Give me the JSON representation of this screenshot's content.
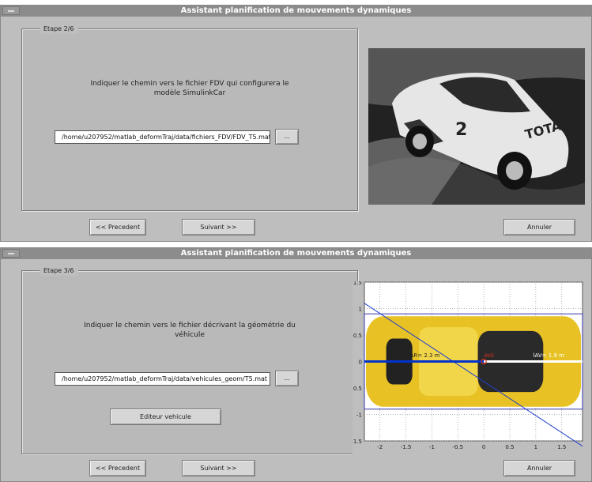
{
  "windows": [
    {
      "title": "Assistant planification de mouvements dynamiques",
      "step": "Etape 2/6",
      "prompt_line1": "Indiquer le chemin vers le fichier FDV qui configurera le",
      "prompt_line2": "modèle SimulinkCar",
      "path": "/home/u207952/matlab_deformTraj/data/fichiers_FDV/FDV_T5.mat",
      "browse_label": "...",
      "prev_label": "<< Precedent",
      "next_label": "Suivant >>",
      "cancel_label": "Annuler"
    },
    {
      "title": "Assistant planification de mouvements dynamiques",
      "step": "Etape 3/6",
      "prompt_line1": "Indiquer le chemin vers le fichier décrivant la géométrie du",
      "prompt_line2": "véhicule",
      "path": "/home/u207952/matlab_deformTraj/data/vehicules_geom/T5.mat",
      "browse_label": "...",
      "editor_label": "Editeur vehicule",
      "prev_label": "<< Precedent",
      "next_label": "Suivant >>",
      "cancel_label": "Annuler"
    }
  ],
  "chart_data": {
    "type": "scatter",
    "xlim": [
      -2.3,
      1.9
    ],
    "ylim": [
      -1.5,
      1.5
    ],
    "x_ticks": [
      -2,
      -1.5,
      -1,
      -0.5,
      0,
      0.5,
      1,
      1.5
    ],
    "y_ticks": [
      1.5,
      1,
      0.5,
      0,
      -0.5,
      -1,
      -1.5
    ],
    "x_tick_labels": [
      "-2",
      "-1.5",
      "-1",
      "-0.5",
      "0",
      "0.5",
      "1",
      "1.5"
    ],
    "y_tick_labels": [
      "1.5",
      "1",
      "0.5",
      "0",
      "0.5",
      "-1",
      "1.5"
    ],
    "grid": true,
    "body_rect": {
      "x": [
        -2.3,
        1.9
      ],
      "y": [
        -0.9,
        0.9
      ]
    },
    "rear_axle_segment": {
      "x": [
        -2.3,
        0
      ],
      "y": [
        0,
        0
      ]
    },
    "front_axle_segment": {
      "x": [
        0,
        1.9
      ],
      "y": [
        0,
        0
      ]
    },
    "diagonal_line": {
      "x": [
        -2.3,
        1.9
      ],
      "y": [
        1.1,
        -1.6
      ]
    },
    "annotations": [
      {
        "text": "lAR= 2.3 m",
        "x": -1.15,
        "y": 0.08
      },
      {
        "text": "lAV= 1.9 m",
        "x": 1.25,
        "y": 0.08
      },
      {
        "text": "AVD",
        "x": 0.1,
        "y": 0.08
      }
    ],
    "colors": {
      "body": "#e8c224",
      "axle_rear": "#0033cc",
      "axle_front": "#ffffff",
      "outline": "#3333aa",
      "diag": "#2040d0",
      "cog": "#e03020"
    }
  }
}
